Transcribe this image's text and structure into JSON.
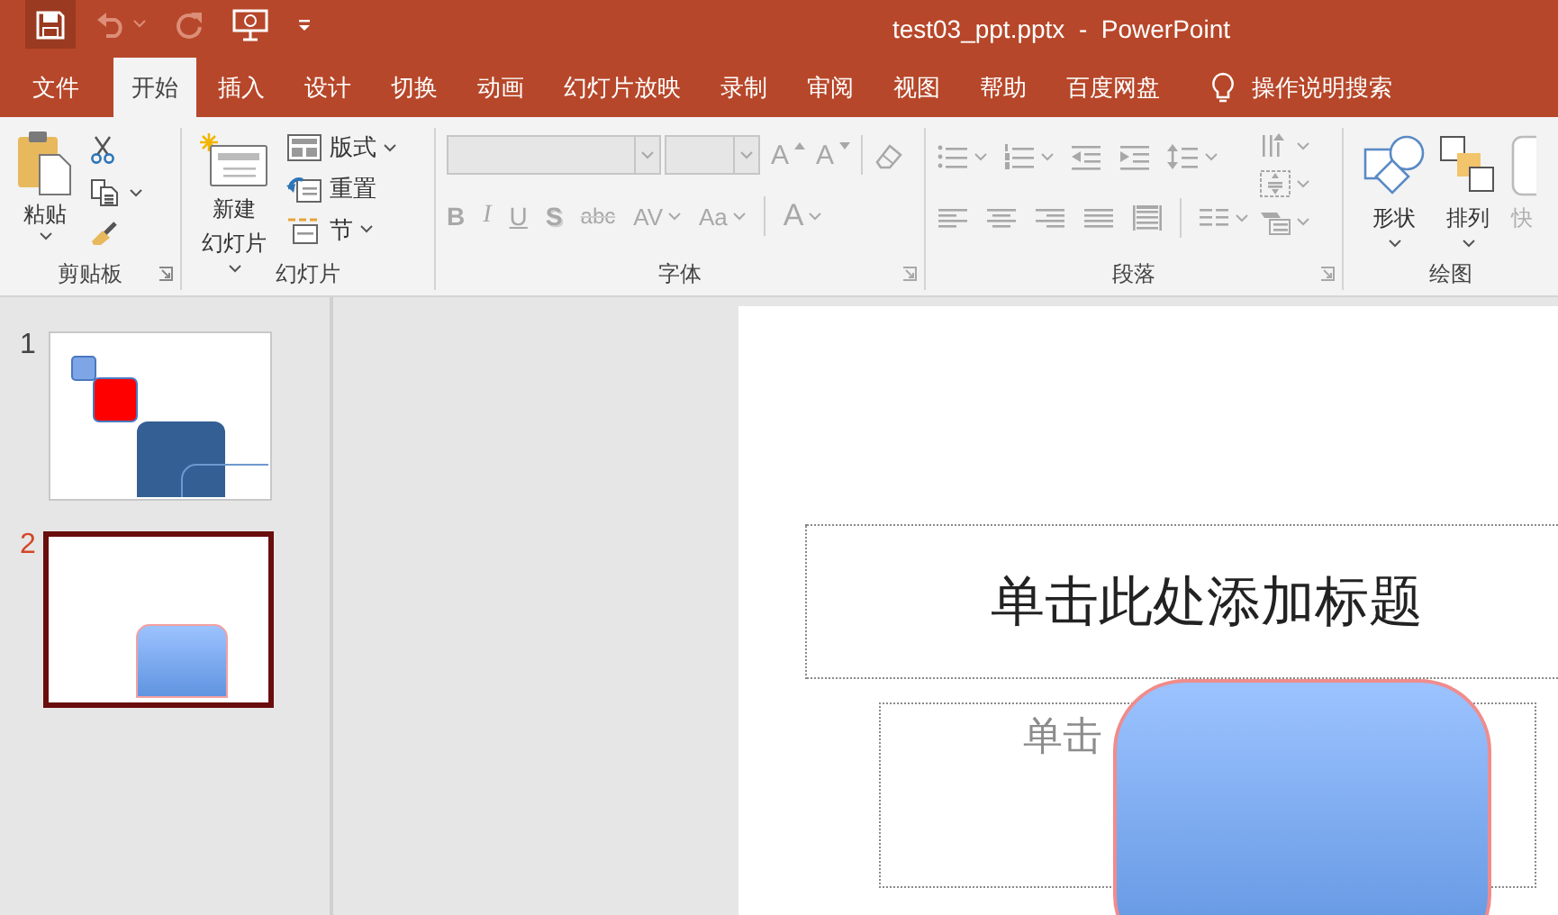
{
  "quick_access": [
    {
      "highlighted": true,
      "disabled": false
    },
    {
      "highlighted": false,
      "disabled": true
    },
    {
      "highlighted": false,
      "disabled": true
    },
    {
      "highlighted": false,
      "disabled": false
    },
    {
      "highlighted": false,
      "disabled": false
    }
  ],
  "window": {
    "title": "test03_ppt.pptx  -  PowerPoint"
  },
  "tabs": [
    {
      "label": "文件",
      "selected": false
    },
    {
      "label": "开始",
      "selected": true
    },
    {
      "label": "插入",
      "selected": false
    },
    {
      "label": "设计",
      "selected": false
    },
    {
      "label": "切换",
      "selected": false
    },
    {
      "label": "动画",
      "selected": false
    },
    {
      "label": "幻灯片放映",
      "selected": false
    },
    {
      "label": "录制",
      "selected": false
    },
    {
      "label": "审阅",
      "selected": false
    },
    {
      "label": "视图",
      "selected": false
    },
    {
      "label": "帮助",
      "selected": false
    },
    {
      "label": "百度网盘",
      "selected": false
    }
  ],
  "search": {
    "label": "操作说明搜索"
  },
  "ribbon": [
    {
      "kind": "clipboard",
      "label": "剪贴板",
      "launcher": true,
      "paste": "粘贴"
    },
    {
      "kind": "slides",
      "label": "幻灯片",
      "launcher": false,
      "new_slide": [
        "新建",
        "幻灯片"
      ],
      "layout": "版式",
      "reset": "重置",
      "section": "节"
    },
    {
      "kind": "font",
      "label": "字体",
      "launcher": true,
      "disabled": true,
      "buttons": [
        {
          "kind": "grow",
          "label": "A"
        },
        {
          "kind": "shrink",
          "label": "A"
        },
        {
          "kind": "bold",
          "label": "B"
        },
        {
          "kind": "italic",
          "label": "I"
        },
        {
          "kind": "underline",
          "label": "U"
        },
        {
          "kind": "shadow",
          "label": "S"
        },
        {
          "kind": "strike",
          "label": "abc"
        },
        {
          "kind": "spacing",
          "label": "AV"
        },
        {
          "kind": "case",
          "label": "Aa"
        },
        {
          "kind": "color",
          "label": "A"
        }
      ]
    },
    {
      "kind": "paragraph",
      "label": "段落",
      "launcher": true,
      "disabled": true
    },
    {
      "kind": "drawing",
      "label": "绘图",
      "launcher": false,
      "buttons": [
        {
          "kind": "shapes",
          "label": "形状",
          "disabled": false
        },
        {
          "kind": "arrange",
          "label": "排列",
          "disabled": false
        },
        {
          "kind": "quick_styles",
          "label": "快",
          "disabled": true
        }
      ]
    }
  ],
  "slides": [
    {
      "number": "1",
      "selected": false
    },
    {
      "number": "2",
      "selected": true
    }
  ],
  "slide": {
    "title_placeholder": "单击此处添加标题",
    "subtitle_placeholder": "单击"
  }
}
